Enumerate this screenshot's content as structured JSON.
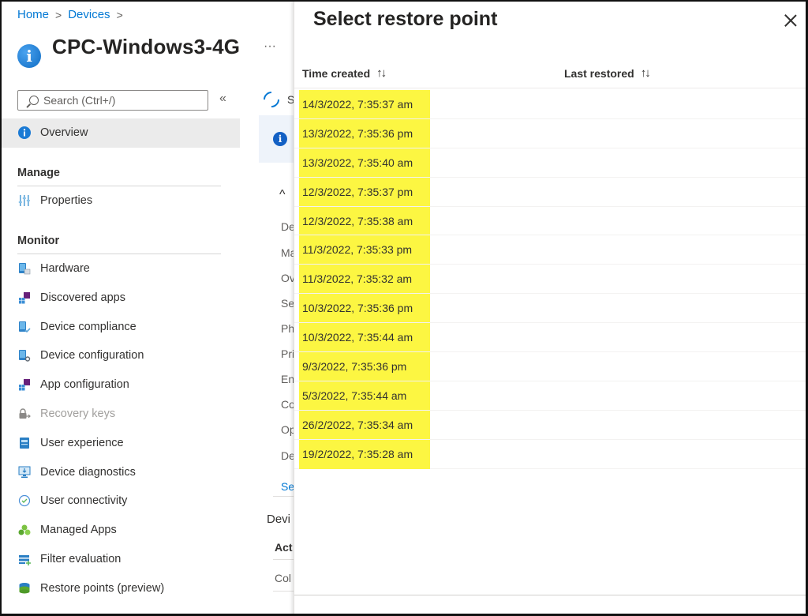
{
  "breadcrumb": [
    {
      "label": "Home"
    },
    {
      "label": "Devices"
    }
  ],
  "breadcrumb_separator": ">",
  "page": {
    "title": "CPC-Windows3-4G",
    "more_label": "···"
  },
  "search": {
    "placeholder": "Search (Ctrl+/)"
  },
  "collapse_label": "«",
  "nav": {
    "overview": "Overview",
    "manage_header": "Manage",
    "manage_items": [
      "Properties"
    ],
    "monitor_header": "Monitor",
    "monitor_items": [
      {
        "label": "Hardware",
        "icon": "hardware-icon"
      },
      {
        "label": "Discovered apps",
        "icon": "discovered-apps-icon"
      },
      {
        "label": "Device compliance",
        "icon": "device-compliance-icon"
      },
      {
        "label": "Device configuration",
        "icon": "device-configuration-icon"
      },
      {
        "label": "App configuration",
        "icon": "app-configuration-icon"
      },
      {
        "label": "Recovery keys",
        "icon": "recovery-keys-icon",
        "disabled": true
      },
      {
        "label": "User experience",
        "icon": "user-experience-icon"
      },
      {
        "label": "Device diagnostics",
        "icon": "device-diagnostics-icon"
      },
      {
        "label": "User connectivity",
        "icon": "user-connectivity-icon"
      },
      {
        "label": "Managed Apps",
        "icon": "managed-apps-icon"
      },
      {
        "label": "Filter evaluation",
        "icon": "filter-evaluation-icon"
      },
      {
        "label": "Restore points (preview)",
        "icon": "restore-points-icon"
      }
    ]
  },
  "middle": {
    "sync_label": "S",
    "fragments": [
      "De",
      "Ma",
      "Ov",
      "Se",
      "Ph",
      "Pri",
      "En",
      "Co",
      "Op",
      "De"
    ],
    "see_more": "Se",
    "section_header": "Devi",
    "table_header": "Act",
    "table_cell": "Col"
  },
  "panel": {
    "title": "Select restore point",
    "columns": [
      {
        "label": "Time created",
        "sort_icon": "↑↓"
      },
      {
        "label": "Last restored",
        "sort_icon": "↑↓"
      }
    ],
    "rows": [
      {
        "time_created": "14/3/2022, 7:35:37 am",
        "last_restored": ""
      },
      {
        "time_created": "13/3/2022, 7:35:36 pm",
        "last_restored": ""
      },
      {
        "time_created": "13/3/2022, 7:35:40 am",
        "last_restored": ""
      },
      {
        "time_created": "12/3/2022, 7:35:37 pm",
        "last_restored": ""
      },
      {
        "time_created": "12/3/2022, 7:35:38 am",
        "last_restored": ""
      },
      {
        "time_created": "11/3/2022, 7:35:33 pm",
        "last_restored": ""
      },
      {
        "time_created": "11/3/2022, 7:35:32 am",
        "last_restored": ""
      },
      {
        "time_created": "10/3/2022, 7:35:36 pm",
        "last_restored": ""
      },
      {
        "time_created": "10/3/2022, 7:35:44 am",
        "last_restored": ""
      },
      {
        "time_created": "9/3/2022, 7:35:36 pm",
        "last_restored": ""
      },
      {
        "time_created": "5/3/2022, 7:35:44 am",
        "last_restored": ""
      },
      {
        "time_created": "26/2/2022, 7:35:34 am",
        "last_restored": ""
      },
      {
        "time_created": "19/2/2022, 7:35:28 am",
        "last_restored": ""
      }
    ],
    "highlight_color": "#fcf642"
  },
  "colors": {
    "accent": "#0078d4",
    "highlight": "#fcf642"
  }
}
